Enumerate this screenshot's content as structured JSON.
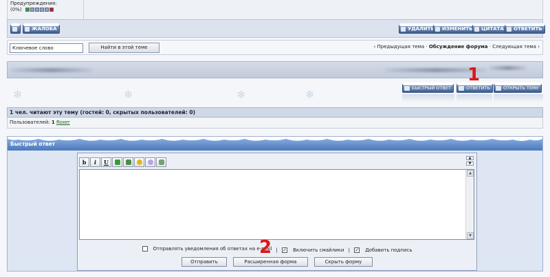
{
  "post": {
    "warnings_label": "Предупреждения:",
    "warnings_percent": "(0%)",
    "warning_level": 0
  },
  "toolbar": {
    "report_label": "ЖАЛОБА",
    "delete_label": "УДАЛИТЬ",
    "edit_label": "ИЗМЕНИТЬ",
    "quote_label": "ЦИТАТА",
    "reply_label": "ОТВЕТИТЬ"
  },
  "search": {
    "value": "Ключевое слово",
    "button_label": "Найти в этой теме"
  },
  "topic_nav": {
    "prev": "‹ Предыдущая тема",
    "sep1": " · ",
    "forum": "Обсуждение форума",
    "sep2": " · ",
    "next": "Следующая тема ›"
  },
  "actions": {
    "quick_reply": "БЫСТРЫЙ ОТВЕТ",
    "reply": "ОТВЕТИТЬ",
    "new_topic": "ОТКРЫТЬ ТЕМУ"
  },
  "markers": {
    "one": "1",
    "two": "2"
  },
  "readers": {
    "heading": "1 чел. читают эту тему (гостей: 0, скрытых пользователей: 0)",
    "users_label": "Пользователей:",
    "users_count": "1",
    "user_name": "Roxer"
  },
  "quick_reply": {
    "title": "Быстрый ответ",
    "editor_buttons": [
      "b",
      "i",
      "U"
    ],
    "notify_label": "Отправлять уведомления об ответах на e-mail",
    "notify_checked": false,
    "smilies_label": "Включить смайлики",
    "smilies_checked": true,
    "signature_label": "Добавить подпись",
    "signature_checked": true,
    "separator": "|",
    "submit_label": "Отправить",
    "advanced_label": "Расширенная форма",
    "hide_label": "Скрыть форму"
  },
  "colors": {
    "accent": "#4b78bc",
    "marker": "#e01515",
    "link_green": "#1a6a1a"
  }
}
